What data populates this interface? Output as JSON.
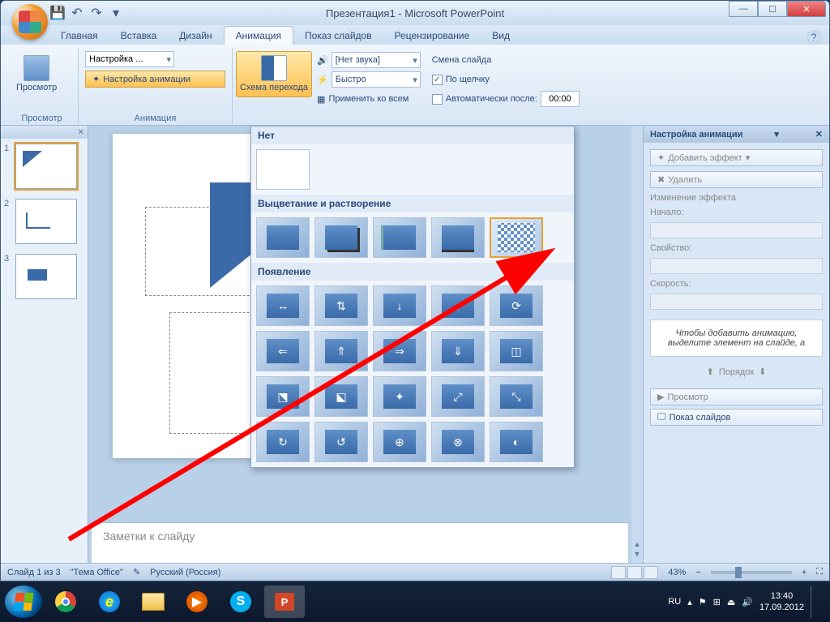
{
  "title": "Презентация1 - Microsoft PowerPoint",
  "tabs": [
    "Главная",
    "Вставка",
    "Дизайн",
    "Анимация",
    "Показ слайдов",
    "Рецензирование",
    "Вид"
  ],
  "active_tab": "Анимация",
  "ribbon": {
    "preview_group": "Просмотр",
    "preview_btn": "Просмотр",
    "anim_group": "Анимация",
    "custom_dd": "Настройка ...",
    "custom_btn": "Настройка анимации",
    "scheme_btn": "Схема перехода",
    "sound_label": "[Нет звука]",
    "speed_label": "Быстро",
    "apply_all": "Применить ко всем",
    "advance_title": "Смена слайда",
    "on_click": "По щелчку",
    "auto_after": "Автоматически после:",
    "auto_time": "00:00"
  },
  "gallery": {
    "none": "Нет",
    "fade": "Выцветание и растворение",
    "appear": "Появление"
  },
  "thumbs": [
    1,
    2,
    3
  ],
  "notes_placeholder": "Заметки к слайду",
  "anim_pane": {
    "title": "Настройка анимации",
    "add_effect": "Добавить эффект",
    "remove": "Удалить",
    "change": "Изменение эффекта",
    "start": "Начало:",
    "property": "Свойство:",
    "speed": "Скорость:",
    "hint": "Чтобы добавить анимацию, выделите элемент на слайде, а",
    "order": "Порядок",
    "preview": "Просмотр",
    "slideshow": "Показ слайдов"
  },
  "status": {
    "slide": "Слайд 1 из 3",
    "theme": "\"Тема Office\"",
    "lang": "Русский (Россия)",
    "zoom": "43%"
  },
  "tray": {
    "lang": "RU",
    "time": "13:40",
    "date": "17.09.2012"
  }
}
